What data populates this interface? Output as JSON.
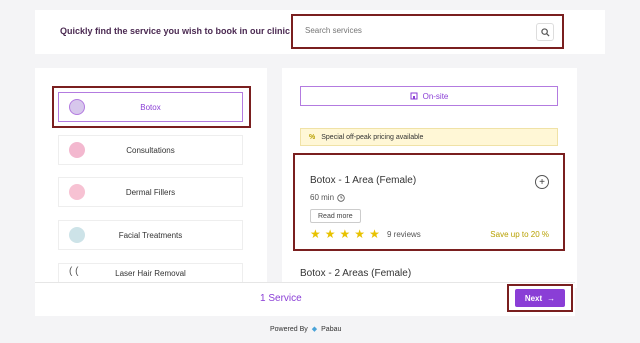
{
  "header": {
    "tagline": "Quickly find the service you wish to book in our clinic",
    "search": {
      "placeholder": "Search services",
      "icon": "search-icon"
    }
  },
  "categories": [
    {
      "label": "Botox",
      "active": true,
      "icon": "avatar-icon"
    },
    {
      "label": "Consultations",
      "active": false,
      "icon": "consultation-icon"
    },
    {
      "label": "Dermal Fillers",
      "active": false,
      "icon": "filler-icon"
    },
    {
      "label": "Facial Treatments",
      "active": false,
      "icon": "facial-icon"
    },
    {
      "label": "Laser Hair Removal",
      "active": false,
      "icon": "laser-icon"
    }
  ],
  "location_toggle": {
    "label": "On-site",
    "icon": "building-icon"
  },
  "offpeak_banner": {
    "label": "Special off-peak pricing available",
    "icon": "percent-icon"
  },
  "service": {
    "name": "Botox - 1 Area (Female)",
    "duration": "60 min",
    "read_more": "Read more",
    "rating": 5,
    "reviews": "9 reviews",
    "savings": "Save up to 20 %"
  },
  "next_service_name": "Botox - 2 Areas (Female)",
  "footer": {
    "count_label": "1 Service",
    "next_label": "Next",
    "powered_by": "Powered By",
    "brand": "Pabau"
  },
  "colors": {
    "accent": "#8a3ed6",
    "star": "#e8c200",
    "highlight_frame": "#7a1f1f"
  }
}
